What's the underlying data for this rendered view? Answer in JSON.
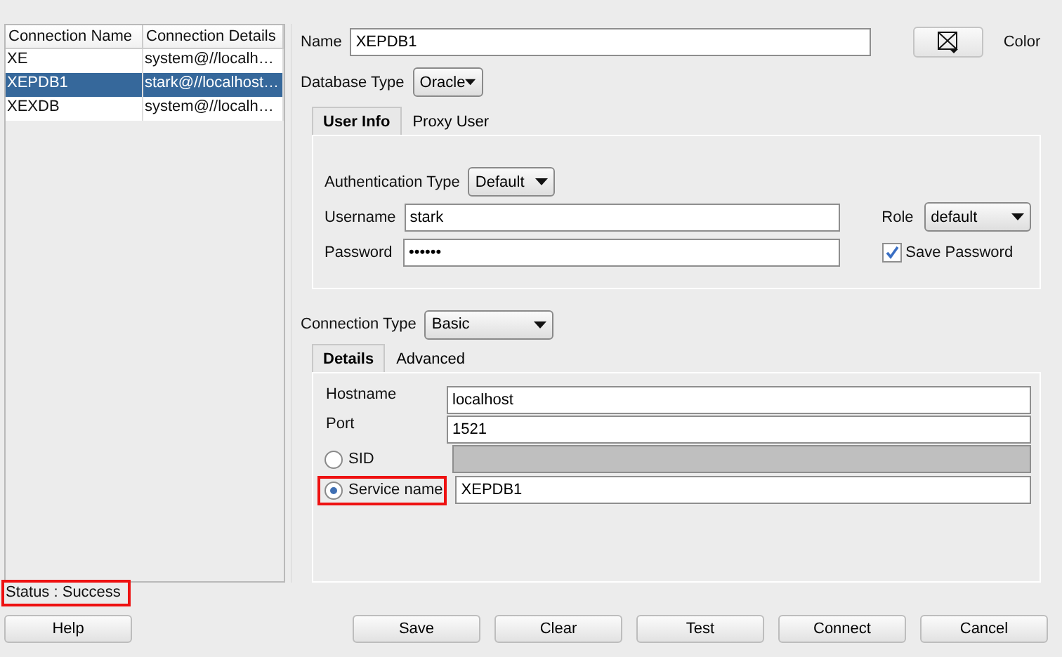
{
  "connections": {
    "columns": [
      "Connection Name",
      "Connection Details"
    ],
    "rows": [
      {
        "name": "XE",
        "details": "system@//localh…",
        "selected": false
      },
      {
        "name": "XEPDB1",
        "details": "stark@//localhost…",
        "selected": true
      },
      {
        "name": "XEXDB",
        "details": "system@//localh…",
        "selected": false
      }
    ]
  },
  "form": {
    "name": {
      "label": "Name",
      "value": "XEPDB1"
    },
    "color_label": "Color",
    "database_type": {
      "label": "Database Type",
      "value": "Oracle"
    },
    "tabs": [
      {
        "label": "User Info",
        "selected": true
      },
      {
        "label": "Proxy User",
        "selected": false
      }
    ],
    "auth_type": {
      "label": "Authentication Type",
      "value": "Default"
    },
    "username": {
      "label": "Username",
      "value": "stark"
    },
    "password": {
      "label": "Password",
      "value": "••••••"
    },
    "role": {
      "label": "Role",
      "value": "default"
    },
    "save_password": {
      "label": "Save Password",
      "checked": true
    },
    "connection_type": {
      "label": "Connection Type",
      "value": "Basic"
    },
    "detail_tabs": [
      {
        "label": "Details",
        "selected": true
      },
      {
        "label": "Advanced",
        "selected": false
      }
    ],
    "fields": [
      {
        "kind": "text",
        "label": "Hostname",
        "value": "localhost"
      },
      {
        "kind": "text",
        "label": "Port",
        "value": "1521"
      },
      {
        "kind": "radio",
        "label": "SID",
        "selected": false,
        "highlighted": false
      },
      {
        "kind": "radio",
        "label": "Service name",
        "selected": true,
        "value": "XEPDB1",
        "highlighted": true
      }
    ]
  },
  "status": {
    "text": "Status : Success",
    "highlighted": true
  },
  "buttons": [
    "Help",
    "Save",
    "Clear",
    "Test",
    "Connect",
    "Cancel"
  ]
}
